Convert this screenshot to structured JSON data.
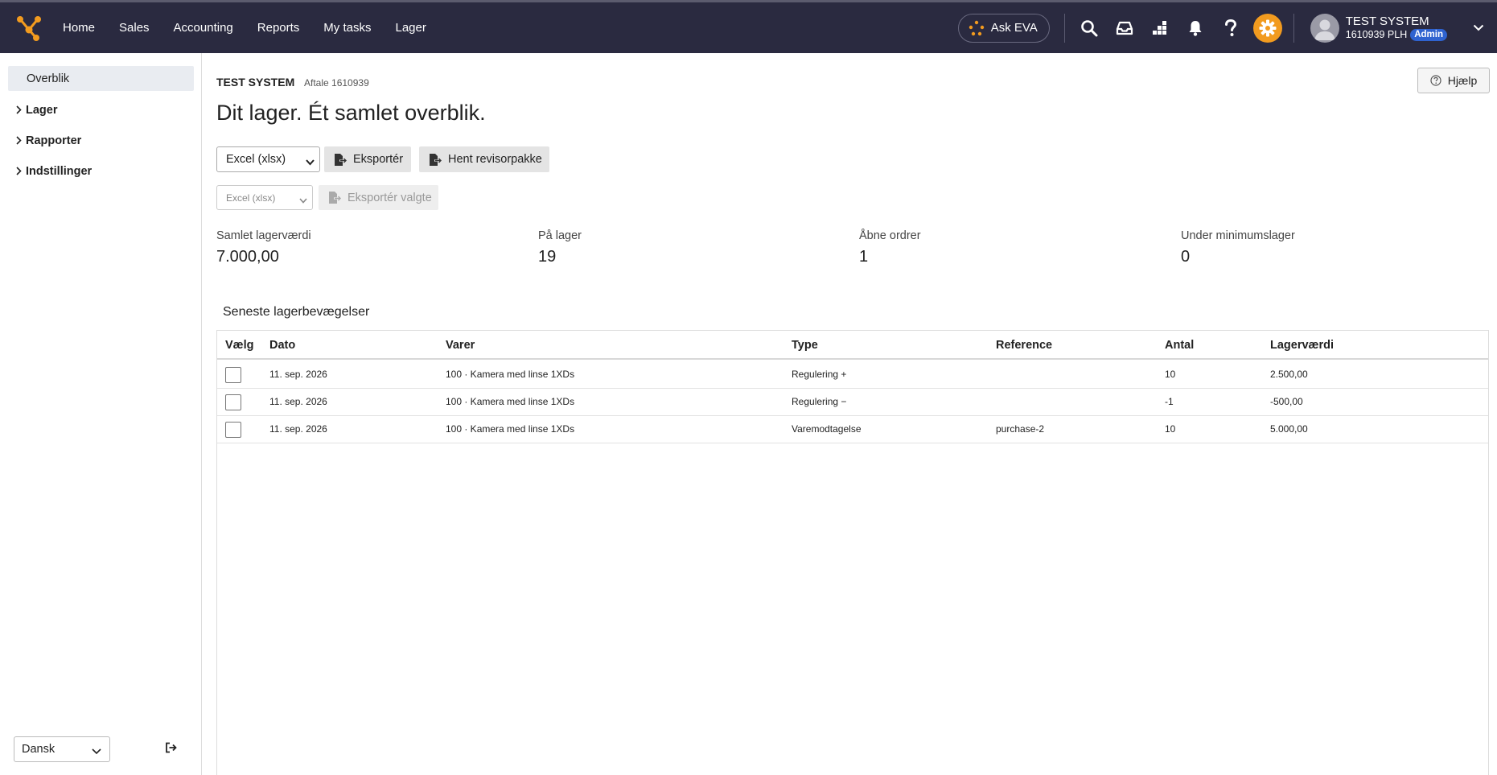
{
  "colors": {
    "topbar": "#2a2a40",
    "accent": "#f29b1f",
    "admin_badge": "#2f63d0",
    "sidebar_active": "#e9ecf1"
  },
  "topbar": {
    "nav": [
      "Home",
      "Sales",
      "Accounting",
      "Reports",
      "My tasks",
      "Lager"
    ],
    "ask_eva": "Ask EVA",
    "icons": [
      "search-icon",
      "inbox-icon",
      "apps-icon",
      "bell-icon",
      "help-icon",
      "gear-icon"
    ],
    "user": {
      "name": "TEST SYSTEM",
      "account": "1610939 PLH",
      "role": "Admin"
    }
  },
  "sidebar": {
    "items": [
      {
        "label": "Overblik"
      },
      {
        "label": "Lager"
      },
      {
        "label": "Rapporter"
      },
      {
        "label": "Indstillinger"
      }
    ],
    "language": "Dansk"
  },
  "header": {
    "company": "TEST SYSTEM",
    "agreement": "Aftale 1610939",
    "help": "Hjælp",
    "title": "Dit lager. Ét samlet overblik."
  },
  "export": {
    "format": "Excel (xlsx)",
    "export_label": "Eksportér",
    "auditor_label": "Hent revisorpakke",
    "selected_format": "Excel (xlsx)",
    "export_selected_label": "Eksportér valgte"
  },
  "stats": [
    {
      "label": "Samlet lagerværdi",
      "value": "7.000,00"
    },
    {
      "label": "På lager",
      "value": "19"
    },
    {
      "label": "Åbne ordrer",
      "value": "1"
    },
    {
      "label": "Under minimumslager",
      "value": "0"
    }
  ],
  "movements": {
    "title": "Seneste lagerbevægelser",
    "columns": [
      "Vælg",
      "Dato",
      "Varer",
      "Type",
      "Reference",
      "Antal",
      "Lagerværdi"
    ],
    "rows": [
      {
        "date": "11. sep. 2026",
        "item": "100 · Kamera med linse 1XDs",
        "type": "Regulering +",
        "reference": "",
        "qty": "10",
        "value": "2.500,00"
      },
      {
        "date": "11. sep. 2026",
        "item": "100 · Kamera med linse 1XDs",
        "type": "Regulering −",
        "reference": "",
        "qty": "-1",
        "value": "-500,00"
      },
      {
        "date": "11. sep. 2026",
        "item": "100 · Kamera med linse 1XDs",
        "type": "Varemodtagelse",
        "reference": "purchase-2",
        "qty": "10",
        "value": "5.000,00"
      }
    ]
  }
}
